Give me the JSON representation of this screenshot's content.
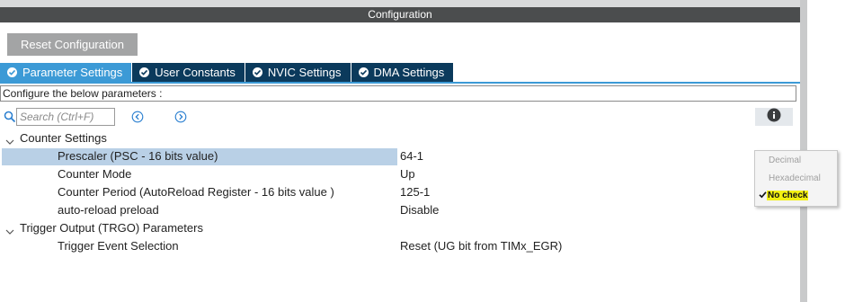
{
  "panel": {
    "title": "Configuration",
    "reset_label": "Reset Configuration"
  },
  "tabs": [
    {
      "label": "Parameter Settings",
      "active": true
    },
    {
      "label": "User Constants",
      "active": false
    },
    {
      "label": "NVIC Settings",
      "active": false
    },
    {
      "label": "DMA Settings",
      "active": false
    }
  ],
  "description": "Configure the below parameters :",
  "search": {
    "placeholder": "Search (Ctrl+F)",
    "icon": "search-icon",
    "prev_icon": "circle-chevron-left-icon",
    "next_icon": "circle-chevron-right-icon"
  },
  "info_icon": "info-icon",
  "groups": [
    {
      "label": "Counter Settings",
      "expanded": true,
      "params": [
        {
          "name": "Prescaler (PSC - 16 bits value)",
          "value": "64-1",
          "selected": true
        },
        {
          "name": "Counter Mode",
          "value": "Up"
        },
        {
          "name": "Counter Period (AutoReload Register - 16 bits value )",
          "value": "125-1"
        },
        {
          "name": "auto-reload preload",
          "value": "Disable"
        }
      ]
    },
    {
      "label": "Trigger Output (TRGO) Parameters",
      "expanded": true,
      "params": [
        {
          "name": "Trigger Event Selection",
          "value": "Reset (UG bit from TIMx_EGR)"
        }
      ]
    }
  ],
  "popup_menu": {
    "options": [
      {
        "label": "Decimal",
        "checked": false
      },
      {
        "label": "Hexadecimal",
        "checked": false
      },
      {
        "label": "No check",
        "checked": true
      }
    ]
  },
  "colors": {
    "header_bg": "#4b4d4e",
    "tab_active": "#3c9ad6",
    "tab_inactive": "#0b3a5c",
    "selection": "#b9d0e6",
    "highlight": "#f2f012"
  }
}
